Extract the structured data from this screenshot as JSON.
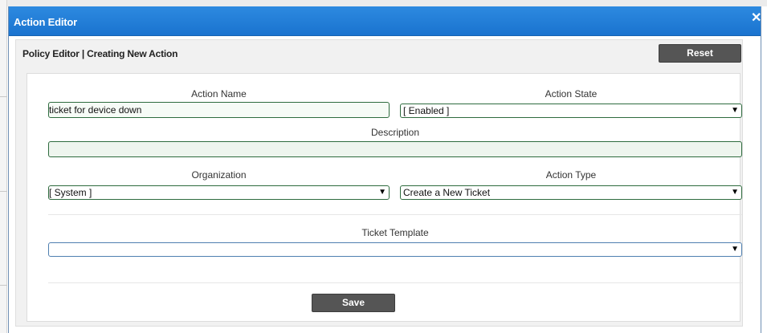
{
  "dialog": {
    "title": "Action Editor",
    "close_glyph": "✕",
    "close_icon": "close-icon"
  },
  "panel": {
    "heading": "Policy Editor | Creating New Action",
    "reset_label": "Reset"
  },
  "form": {
    "action_name": {
      "label": "Action Name",
      "value": "ticket for device down"
    },
    "action_state": {
      "label": "Action State",
      "value": "[ Enabled ]"
    },
    "description": {
      "label": "Description",
      "value": ""
    },
    "organization": {
      "label": "Organization",
      "value": "[ System ]"
    },
    "action_type": {
      "label": "Action Type",
      "value": "Create a New Ticket"
    },
    "ticket_template": {
      "label": "Ticket Template",
      "value": ""
    },
    "dropdown_arrow": "▼",
    "save_label": "Save"
  },
  "colors": {
    "titlebar": "#1a73cf",
    "button": "#555555",
    "input_border": "#2e6b3e"
  }
}
